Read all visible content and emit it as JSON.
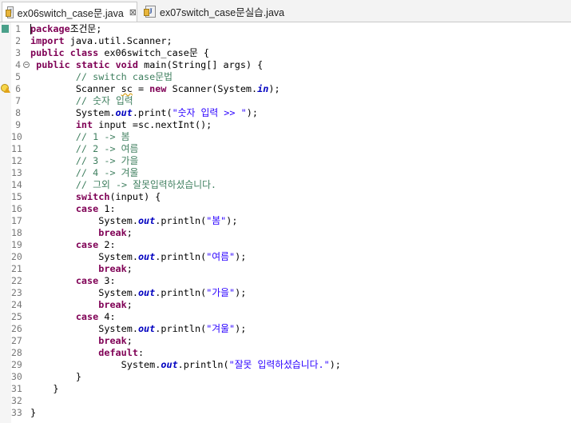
{
  "tabs": [
    {
      "label": "ex06switch_case문.java",
      "active": true,
      "close": "⊠"
    },
    {
      "label": "ex07switch_case문실습.java",
      "active": false
    }
  ],
  "lines": [
    {
      "n": "1",
      "t": [
        [
          "kw",
          "package"
        ],
        [
          "",
          "조건문;"
        ]
      ]
    },
    {
      "n": "2",
      "t": [
        [
          "kw",
          "import"
        ],
        [
          "",
          " java.util.Scanner;"
        ]
      ]
    },
    {
      "n": "3",
      "t": [
        [
          "kw",
          "public"
        ],
        [
          "",
          " "
        ],
        [
          "kw",
          "class"
        ],
        [
          "",
          " ex06switch_case문 {"
        ]
      ]
    },
    {
      "n": "4",
      "t": [
        [
          "",
          " "
        ],
        [
          "kw",
          "public"
        ],
        [
          "",
          " "
        ],
        [
          "kw",
          "static"
        ],
        [
          "",
          " "
        ],
        [
          "kw",
          "void"
        ],
        [
          "",
          " main(String[] args) {"
        ]
      ]
    },
    {
      "n": "5",
      "t": [
        [
          "",
          "        "
        ],
        [
          "cm",
          "// switch case문법"
        ]
      ]
    },
    {
      "n": "6",
      "t": [
        [
          "",
          "        Scanner "
        ],
        [
          "warn",
          "sc"
        ],
        [
          "",
          " = "
        ],
        [
          "kw",
          "new"
        ],
        [
          "",
          " Scanner(System."
        ],
        [
          "fd",
          "in"
        ],
        [
          "",
          ");"
        ]
      ]
    },
    {
      "n": "7",
      "t": [
        [
          "",
          "        "
        ],
        [
          "cm",
          "// 숫자 입력"
        ]
      ]
    },
    {
      "n": "8",
      "t": [
        [
          "",
          "        System."
        ],
        [
          "fd",
          "out"
        ],
        [
          "",
          ".print("
        ],
        [
          "st",
          "\"숫자 입력 >> \""
        ],
        [
          "",
          ");"
        ]
      ]
    },
    {
      "n": "9",
      "t": [
        [
          "",
          "        "
        ],
        [
          "kw",
          "int"
        ],
        [
          "",
          " input =sc.nextInt();"
        ]
      ]
    },
    {
      "n": "10",
      "t": [
        [
          "",
          "        "
        ],
        [
          "cm",
          "// 1 -> 봄"
        ]
      ]
    },
    {
      "n": "11",
      "t": [
        [
          "",
          "        "
        ],
        [
          "cm",
          "// 2 -> 여름"
        ]
      ]
    },
    {
      "n": "12",
      "t": [
        [
          "",
          "        "
        ],
        [
          "cm",
          "// 3 -> 가을"
        ]
      ]
    },
    {
      "n": "13",
      "t": [
        [
          "",
          "        "
        ],
        [
          "cm",
          "// 4 -> 겨울"
        ]
      ]
    },
    {
      "n": "14",
      "t": [
        [
          "",
          "        "
        ],
        [
          "cm",
          "// 그외 -> 잘못입력하셨습니다."
        ]
      ]
    },
    {
      "n": "15",
      "t": [
        [
          "",
          "        "
        ],
        [
          "kw",
          "switch"
        ],
        [
          "",
          "(input) {"
        ]
      ]
    },
    {
      "n": "16",
      "t": [
        [
          "",
          "        "
        ],
        [
          "kw",
          "case"
        ],
        [
          "",
          " 1:"
        ]
      ]
    },
    {
      "n": "17",
      "t": [
        [
          "",
          "            System."
        ],
        [
          "fd",
          "out"
        ],
        [
          "",
          ".println("
        ],
        [
          "st",
          "\"봄\""
        ],
        [
          "",
          ");"
        ]
      ]
    },
    {
      "n": "18",
      "t": [
        [
          "",
          "            "
        ],
        [
          "kw",
          "break"
        ],
        [
          "",
          ";"
        ]
      ]
    },
    {
      "n": "19",
      "t": [
        [
          "",
          "        "
        ],
        [
          "kw",
          "case"
        ],
        [
          "",
          " 2:"
        ]
      ]
    },
    {
      "n": "20",
      "t": [
        [
          "",
          "            System."
        ],
        [
          "fd",
          "out"
        ],
        [
          "",
          ".println("
        ],
        [
          "st",
          "\"여름\""
        ],
        [
          "",
          ");"
        ]
      ]
    },
    {
      "n": "21",
      "t": [
        [
          "",
          "            "
        ],
        [
          "kw",
          "break"
        ],
        [
          "",
          ";"
        ]
      ]
    },
    {
      "n": "22",
      "t": [
        [
          "",
          "        "
        ],
        [
          "kw",
          "case"
        ],
        [
          "",
          " 3:"
        ]
      ]
    },
    {
      "n": "23",
      "t": [
        [
          "",
          "            System."
        ],
        [
          "fd",
          "out"
        ],
        [
          "",
          ".println("
        ],
        [
          "st",
          "\"가을\""
        ],
        [
          "",
          ");"
        ]
      ]
    },
    {
      "n": "24",
      "t": [
        [
          "",
          "            "
        ],
        [
          "kw",
          "break"
        ],
        [
          "",
          ";"
        ]
      ]
    },
    {
      "n": "25",
      "t": [
        [
          "",
          "        "
        ],
        [
          "kw",
          "case"
        ],
        [
          "",
          " 4:"
        ]
      ]
    },
    {
      "n": "26",
      "t": [
        [
          "",
          "            System."
        ],
        [
          "fd",
          "out"
        ],
        [
          "",
          ".println("
        ],
        [
          "st",
          "\"겨울\""
        ],
        [
          "",
          ");"
        ]
      ]
    },
    {
      "n": "27",
      "t": [
        [
          "",
          "            "
        ],
        [
          "kw",
          "break"
        ],
        [
          "",
          ";"
        ]
      ]
    },
    {
      "n": "28",
      "t": [
        [
          "",
          "            "
        ],
        [
          "kw",
          "default"
        ],
        [
          "",
          ":"
        ]
      ]
    },
    {
      "n": "29",
      "t": [
        [
          "",
          "                System."
        ],
        [
          "fd",
          "out"
        ],
        [
          "",
          ".println("
        ],
        [
          "st",
          "\"잘못 입력하셨습니다.\""
        ],
        [
          "",
          ");"
        ]
      ]
    },
    {
      "n": "30",
      "t": [
        [
          "",
          "        }"
        ]
      ]
    },
    {
      "n": "31",
      "t": [
        [
          "",
          "    }"
        ]
      ]
    },
    {
      "n": "32",
      "t": [
        [
          "",
          ""
        ]
      ]
    },
    {
      "n": "33",
      "t": [
        [
          "",
          "}"
        ]
      ]
    }
  ],
  "markers": {
    "bookmark_line": "1",
    "warning_line": "6",
    "fold_line": "4",
    "fold_symbol": "⊖"
  },
  "colors": {
    "keyword": "#7f0055",
    "comment": "#3f7f5f",
    "string": "#2a00ff",
    "field": "#0000c0"
  }
}
